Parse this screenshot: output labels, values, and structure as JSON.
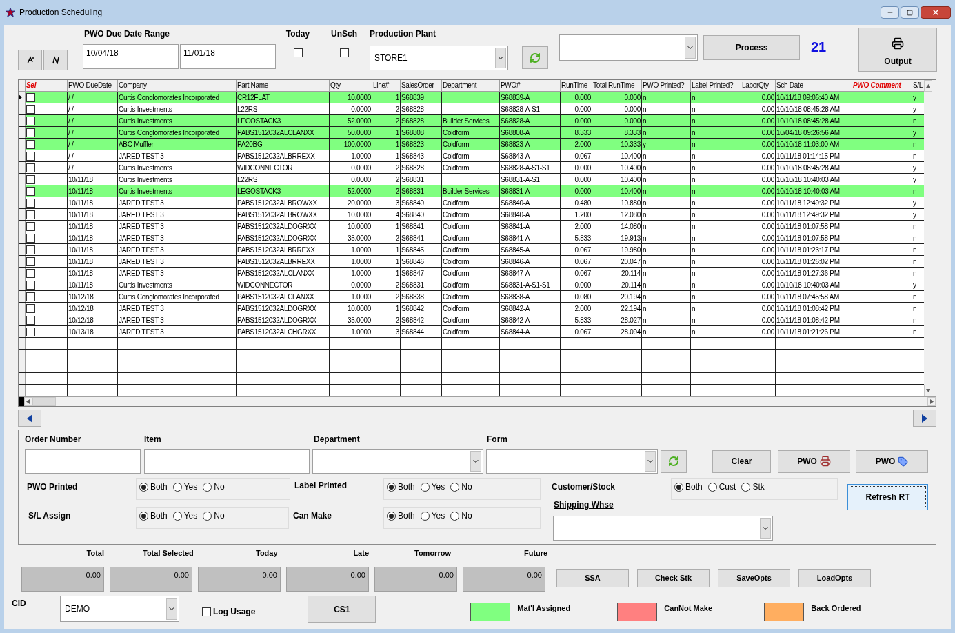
{
  "window": {
    "title": "Production Scheduling"
  },
  "toolbar": {
    "date_range": {
      "label": "PWO Due Date Range",
      "from": "10/04/18",
      "to": "11/01/18"
    },
    "today": {
      "label": "Today",
      "checked": false
    },
    "unsch": {
      "label": "UnSch",
      "checked": false
    },
    "plant": {
      "label": "Production Plant",
      "value": "STORE1"
    },
    "process_button": "Process",
    "count": "21",
    "output_button": "Output"
  },
  "table": {
    "columns": [
      {
        "label": "Sel",
        "kind": "select",
        "accent": true
      },
      {
        "label": "PWO DueDate",
        "kind": "text",
        "accent": false
      },
      {
        "label": "Company",
        "kind": "text",
        "accent": false
      },
      {
        "label": "Part Name",
        "kind": "text",
        "accent": false
      },
      {
        "label": "Qty",
        "kind": "number",
        "accent": false
      },
      {
        "label": "Line#",
        "kind": "number",
        "accent": false
      },
      {
        "label": "SalesOrder",
        "kind": "text",
        "accent": false
      },
      {
        "label": "Department",
        "kind": "text",
        "accent": false
      },
      {
        "label": "PWO#",
        "kind": "text",
        "accent": false
      },
      {
        "label": "RunTime",
        "kind": "number",
        "accent": false
      },
      {
        "label": "Total RunTime",
        "kind": "number",
        "accent": false
      },
      {
        "label": "PWO Printed?",
        "kind": "text",
        "accent": false
      },
      {
        "label": "Label Printed?",
        "kind": "text",
        "accent": false
      },
      {
        "label": "LaborQty",
        "kind": "number",
        "accent": false
      },
      {
        "label": "Sch Date",
        "kind": "text",
        "accent": false
      },
      {
        "label": "PWO Comment",
        "kind": "text",
        "accent": true
      },
      {
        "label": "S/L",
        "kind": "text",
        "accent": false
      }
    ],
    "rows": [
      {
        "current": true,
        "checked": false,
        "matl_assigned": true,
        "cells": [
          "",
          "/ /",
          "Curtis Conglomorates Incorporated",
          "CR12FLAT",
          "10.0000",
          "1",
          "S68839",
          "",
          "S68839-A",
          "0.000",
          "0.000",
          "n",
          "n",
          "0.00",
          "10/11/18 09:06:40 AM",
          "",
          "y"
        ]
      },
      {
        "current": false,
        "checked": false,
        "matl_assigned": false,
        "cells": [
          "",
          "/ /",
          "Curtis Investments",
          "L22RS",
          "0.0000",
          "2",
          "S68828",
          "",
          "S68828-A-S1",
          "0.000",
          "0.000",
          "n",
          "n",
          "0.00",
          "10/10/18 08:45:28 AM",
          "",
          "y"
        ]
      },
      {
        "current": false,
        "checked": false,
        "matl_assigned": true,
        "cells": [
          "",
          "/ /",
          "Curtis Investments",
          "LEGOSTACK3",
          "52.0000",
          "2",
          "S68828",
          "Builder Services",
          "S68828-A",
          "0.000",
          "0.000",
          "n",
          "n",
          "0.00",
          "10/10/18 08:45:28 AM",
          "",
          "n"
        ]
      },
      {
        "current": false,
        "checked": false,
        "matl_assigned": true,
        "cells": [
          "",
          "/ /",
          "Curtis Conglomorates Incorporated",
          "PABS1512032ALCLANXX",
          "50.0000",
          "1",
          "S68808",
          "Coldform",
          "S68808-A",
          "8.333",
          "8.333",
          "n",
          "n",
          "0.00",
          "10/04/18 09:26:56 AM",
          "",
          "y"
        ]
      },
      {
        "current": false,
        "checked": false,
        "matl_assigned": true,
        "cells": [
          "",
          "/ /",
          "ABC Muffler",
          "PA20BG",
          "100.0000",
          "1",
          "S68823",
          "Coldform",
          "S68823-A",
          "2.000",
          "10.333",
          "y",
          "n",
          "0.00",
          "10/10/18 11:03:00 AM",
          "",
          "n"
        ]
      },
      {
        "current": false,
        "checked": false,
        "matl_assigned": false,
        "cells": [
          "",
          "/ /",
          "JARED TEST 3",
          "PABS1512032ALBRREXX",
          "1.0000",
          "1",
          "S68843",
          "Coldform",
          "S68843-A",
          "0.067",
          "10.400",
          "n",
          "n",
          "0.00",
          "10/11/18 01:14:15 PM",
          "",
          "n"
        ]
      },
      {
        "current": false,
        "checked": false,
        "matl_assigned": false,
        "cells": [
          "",
          "/ /",
          "Curtis Investments",
          "WIDCONNECTOR",
          "0.0000",
          "2",
          "S68828",
          "Coldform",
          "S68828-A-S1-S1",
          "0.000",
          "10.400",
          "n",
          "n",
          "0.00",
          "10/10/18 08:45:28 AM",
          "",
          "y"
        ]
      },
      {
        "current": false,
        "checked": false,
        "matl_assigned": false,
        "cells": [
          "",
          "10/11/18",
          "Curtis Investments",
          "L22RS",
          "0.0000",
          "2",
          "S68831",
          "",
          "S68831-A-S1",
          "0.000",
          "10.400",
          "n",
          "n",
          "0.00",
          "10/10/18 10:40:03 AM",
          "",
          "y"
        ]
      },
      {
        "current": false,
        "checked": false,
        "matl_assigned": true,
        "cells": [
          "",
          "10/11/18",
          "Curtis Investments",
          "LEGOSTACK3",
          "52.0000",
          "2",
          "S68831",
          "Builder Services",
          "S68831-A",
          "0.000",
          "10.400",
          "n",
          "n",
          "0.00",
          "10/10/18 10:40:03 AM",
          "",
          "n"
        ]
      },
      {
        "current": false,
        "checked": false,
        "matl_assigned": false,
        "cells": [
          "",
          "10/11/18",
          "JARED TEST 3",
          "PABS1512032ALBROWXX",
          "20.0000",
          "3",
          "S68840",
          "Coldform",
          "S68840-A",
          "0.480",
          "10.880",
          "n",
          "n",
          "0.00",
          "10/11/18 12:49:32 PM",
          "",
          "y"
        ]
      },
      {
        "current": false,
        "checked": false,
        "matl_assigned": false,
        "cells": [
          "",
          "10/11/18",
          "JARED TEST 3",
          "PABS1512032ALBROWXX",
          "10.0000",
          "4",
          "S68840",
          "Coldform",
          "S68840-A",
          "1.200",
          "12.080",
          "n",
          "n",
          "0.00",
          "10/11/18 12:49:32 PM",
          "",
          "y"
        ]
      },
      {
        "current": false,
        "checked": false,
        "matl_assigned": false,
        "cells": [
          "",
          "10/11/18",
          "JARED TEST 3",
          "PABS1512032ALDOGRXX",
          "10.0000",
          "1",
          "S68841",
          "Coldform",
          "S68841-A",
          "2.000",
          "14.080",
          "n",
          "n",
          "0.00",
          "10/11/18 01:07:58 PM",
          "",
          "n"
        ]
      },
      {
        "current": false,
        "checked": false,
        "matl_assigned": false,
        "cells": [
          "",
          "10/11/18",
          "JARED TEST 3",
          "PABS1512032ALDOGRXX",
          "35.0000",
          "2",
          "S68841",
          "Coldform",
          "S68841-A",
          "5.833",
          "19.913",
          "n",
          "n",
          "0.00",
          "10/11/18 01:07:58 PM",
          "",
          "n"
        ]
      },
      {
        "current": false,
        "checked": false,
        "matl_assigned": false,
        "cells": [
          "",
          "10/11/18",
          "JARED TEST 3",
          "PABS1512032ALBRREXX",
          "1.0000",
          "1",
          "S68845",
          "Coldform",
          "S68845-A",
          "0.067",
          "19.980",
          "n",
          "n",
          "0.00",
          "10/11/18 01:23:17 PM",
          "",
          "n"
        ]
      },
      {
        "current": false,
        "checked": false,
        "matl_assigned": false,
        "cells": [
          "",
          "10/11/18",
          "JARED TEST 3",
          "PABS1512032ALBRREXX",
          "1.0000",
          "1",
          "S68846",
          "Coldform",
          "S68846-A",
          "0.067",
          "20.047",
          "n",
          "n",
          "0.00",
          "10/11/18 01:26:02 PM",
          "",
          "n"
        ]
      },
      {
        "current": false,
        "checked": false,
        "matl_assigned": false,
        "cells": [
          "",
          "10/11/18",
          "JARED TEST 3",
          "PABS1512032ALCLANXX",
          "1.0000",
          "1",
          "S68847",
          "Coldform",
          "S68847-A",
          "0.067",
          "20.114",
          "n",
          "n",
          "0.00",
          "10/11/18 01:27:36 PM",
          "",
          "n"
        ]
      },
      {
        "current": false,
        "checked": false,
        "matl_assigned": false,
        "cells": [
          "",
          "10/11/18",
          "Curtis Investments",
          "WIDCONNECTOR",
          "0.0000",
          "2",
          "S68831",
          "Coldform",
          "S68831-A-S1-S1",
          "0.000",
          "20.114",
          "n",
          "n",
          "0.00",
          "10/10/18 10:40:03 AM",
          "",
          "y"
        ]
      },
      {
        "current": false,
        "checked": false,
        "matl_assigned": false,
        "cells": [
          "",
          "10/12/18",
          "Curtis Conglomorates Incorporated",
          "PABS1512032ALCLANXX",
          "1.0000",
          "2",
          "S68838",
          "Coldform",
          "S68838-A",
          "0.080",
          "20.194",
          "n",
          "n",
          "0.00",
          "10/11/18 07:45:58 AM",
          "",
          "n"
        ]
      },
      {
        "current": false,
        "checked": false,
        "matl_assigned": false,
        "cells": [
          "",
          "10/12/18",
          "JARED TEST 3",
          "PABS1512032ALDOGRXX",
          "10.0000",
          "1",
          "S68842",
          "Coldform",
          "S68842-A",
          "2.000",
          "22.194",
          "n",
          "n",
          "0.00",
          "10/11/18 01:08:42 PM",
          "",
          "n"
        ]
      },
      {
        "current": false,
        "checked": false,
        "matl_assigned": false,
        "cells": [
          "",
          "10/12/18",
          "JARED TEST 3",
          "PABS1512032ALDOGRXX",
          "35.0000",
          "2",
          "S68842",
          "Coldform",
          "S68842-A",
          "5.833",
          "28.027",
          "n",
          "n",
          "0.00",
          "10/11/18 01:08:42 PM",
          "",
          "n"
        ]
      },
      {
        "current": false,
        "checked": false,
        "matl_assigned": false,
        "cells": [
          "",
          "10/13/18",
          "JARED TEST 3",
          "PABS1512032ALCHGRXX",
          "1.0000",
          "3",
          "S68844",
          "Coldform",
          "S68844-A",
          "0.067",
          "28.094",
          "n",
          "n",
          "0.00",
          "10/11/18 01:21:26 PM",
          "",
          "n"
        ]
      }
    ]
  },
  "filters": {
    "order_number": "Order Number",
    "item": "Item",
    "department": "Department",
    "form": "Form",
    "clear_button": "Clear",
    "pwo_print_button": "PWO",
    "pwo_label_button": "PWO",
    "radio_groups": [
      {
        "label": "PWO Printed",
        "options": [
          {
            "label": "Both",
            "selected": true
          },
          {
            "label": "Yes",
            "selected": false
          },
          {
            "label": "No",
            "selected": false
          }
        ]
      },
      {
        "label": "Label Printed",
        "options": [
          {
            "label": "Both",
            "selected": true
          },
          {
            "label": "Yes",
            "selected": false
          },
          {
            "label": "No",
            "selected": false
          }
        ]
      },
      {
        "label": "Customer/Stock",
        "options": [
          {
            "label": "Both",
            "selected": true
          },
          {
            "label": "Cust",
            "selected": false
          },
          {
            "label": "Stk",
            "selected": false
          }
        ]
      },
      {
        "label": "S/L Assign",
        "options": [
          {
            "label": "Both",
            "selected": true
          },
          {
            "label": "Yes",
            "selected": false
          },
          {
            "label": "No",
            "selected": false
          }
        ]
      },
      {
        "label": "Can Make",
        "options": [
          {
            "label": "Both",
            "selected": true
          },
          {
            "label": "Yes",
            "selected": false
          },
          {
            "label": "No",
            "selected": false
          }
        ]
      }
    ],
    "shipping_whse": "Shipping Whse",
    "refresh_button": "Refresh RT"
  },
  "totals": [
    {
      "label": "Total",
      "value": "0.00"
    },
    {
      "label": "Total Selected",
      "value": "0.00"
    },
    {
      "label": "Today",
      "value": "0.00"
    },
    {
      "label": "Late",
      "value": "0.00"
    },
    {
      "label": "Tomorrow",
      "value": "0.00"
    },
    {
      "label": "Future",
      "value": "0.00"
    }
  ],
  "actions": [
    "SSA",
    "Check Stk",
    "SaveOpts",
    "LoadOpts"
  ],
  "cid": {
    "label": "CID",
    "value": "DEMO"
  },
  "log_usage": {
    "label": "Log Usage",
    "checked": false
  },
  "cs1_button": "CS1",
  "legend": [
    {
      "label": "Mat'l Assigned",
      "color": "#80ff80"
    },
    {
      "label": "CanNot Make",
      "color": "#ff8080"
    },
    {
      "label": "Back Ordered",
      "color": "#ffae60"
    }
  ]
}
